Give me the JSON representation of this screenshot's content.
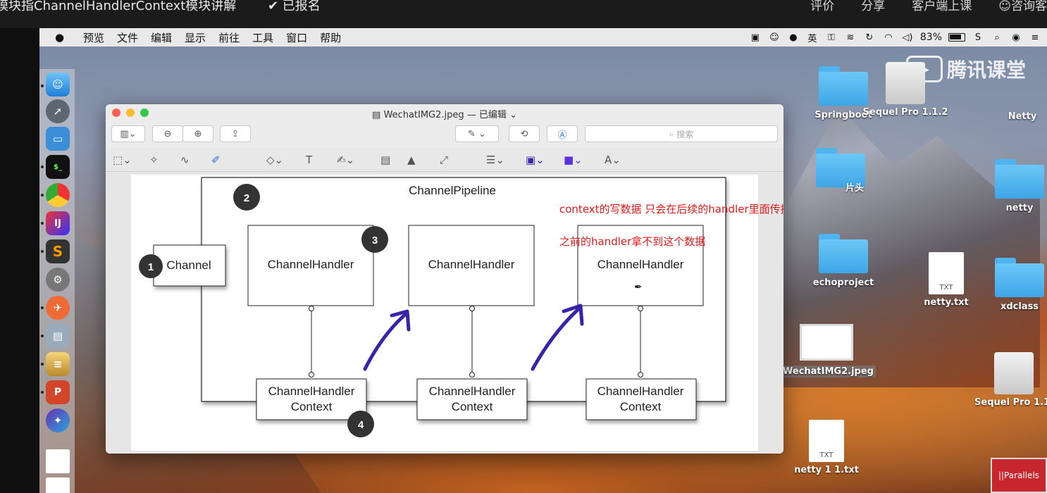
{
  "course": {
    "title": "模块指ChannelHandlerContext模块讲解",
    "status": "✔ 已报名",
    "actions": [
      "评价",
      "分享",
      "客户端上课",
      "☺咨询客"
    ]
  },
  "menubar": {
    "items": [
      "预览",
      "文件",
      "编辑",
      "显示",
      "前往",
      "工具",
      "窗口",
      "帮助"
    ],
    "battery": "83%"
  },
  "window": {
    "title": "WechatIMG2.jpeg — 已编辑",
    "search_placeholder": "搜索"
  },
  "diagram": {
    "pipeline_label": "ChannelPipeline",
    "channel_label": "Channel",
    "handler_label": "ChannelHandler",
    "context_line1": "ChannelHandler",
    "context_line2": "Context",
    "badges": [
      "1",
      "2",
      "3",
      "4"
    ],
    "arrow_color": "#3a23a8"
  },
  "annotations": {
    "line1": "context的写数据 只会在后续的handler里面传播",
    "line2": "之前的handler拿不到这个数据"
  },
  "desktop_icons": {
    "springboot": "Springboot",
    "sequel_pro": "Sequel Pro 1.1.2",
    "netty": "Netty",
    "pian_tou": "片头",
    "netty_lower": "netty",
    "echoproject": "echoproject",
    "netty_txt": "netty.txt",
    "xdclass": "xdclass",
    "wechat_img": "WechatIMG2.jpeg",
    "sequel_pro_2": "Sequel Pro 1.1.",
    "netty_1_txt": "netty 1 1.txt",
    "txt_badge": "TXT"
  },
  "watermark": "腾讯课堂",
  "parallels": "||Parallels"
}
